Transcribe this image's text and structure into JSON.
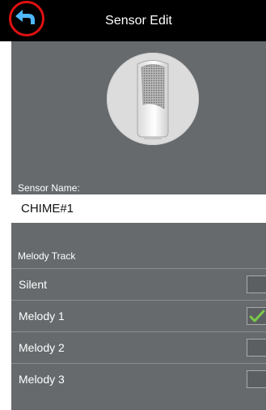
{
  "header": {
    "title": "Sensor Edit",
    "back_icon": "back-arrow-icon"
  },
  "sensor_image": {
    "icon": "chime-sensor-device"
  },
  "sensor_name": {
    "label": "Sensor Name:",
    "value": "CHIME#1"
  },
  "melody": {
    "label": "Melody Track",
    "options": [
      {
        "label": "Silent",
        "checked": false
      },
      {
        "label": "Melody 1",
        "checked": true
      },
      {
        "label": "Melody 2",
        "checked": false
      },
      {
        "label": "Melody 3",
        "checked": false
      }
    ]
  },
  "colors": {
    "header": "#000000",
    "panel": "#666a6d",
    "highlight_ring": "#e01010",
    "check": "#7bc94a"
  }
}
